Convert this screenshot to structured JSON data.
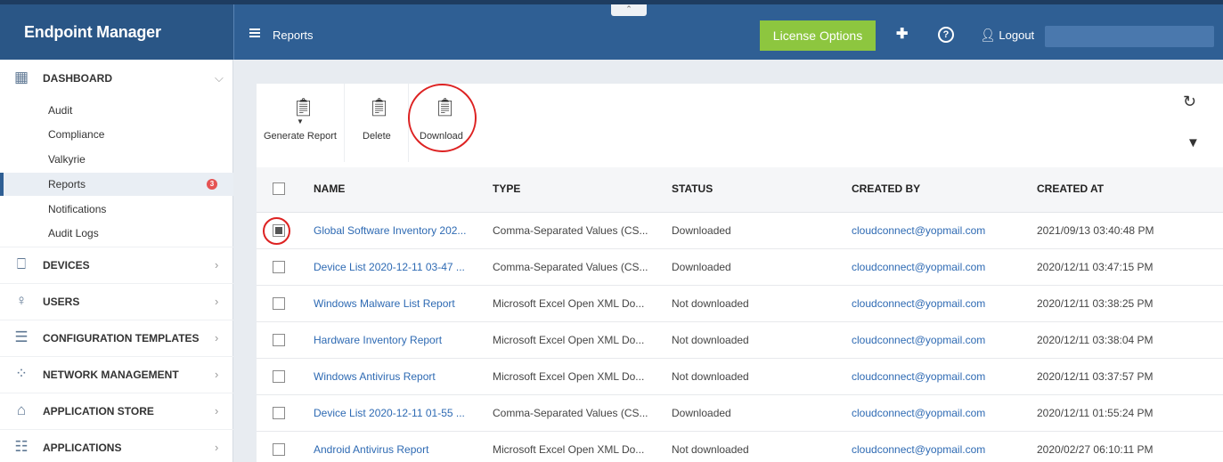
{
  "app": {
    "brand": "Endpoint Manager",
    "page_title": "Reports",
    "license_button": "License Options",
    "logout_label": "Logout"
  },
  "sidebar": {
    "dashboard": {
      "label": "DASHBOARD",
      "icon": "dashboard-grid-icon"
    },
    "sub_items": [
      {
        "label": "Audit"
      },
      {
        "label": "Compliance"
      },
      {
        "label": "Valkyrie"
      },
      {
        "label": "Reports",
        "active": true,
        "badge": "3"
      },
      {
        "label": "Notifications"
      },
      {
        "label": "Audit Logs"
      }
    ],
    "groups": [
      {
        "label": "DEVICES",
        "icon": "devices-icon"
      },
      {
        "label": "USERS",
        "icon": "user-icon"
      },
      {
        "label": "CONFIGURATION TEMPLATES",
        "icon": "templates-icon"
      },
      {
        "label": "NETWORK MANAGEMENT",
        "icon": "network-icon"
      },
      {
        "label": "APPLICATION STORE",
        "icon": "store-icon"
      },
      {
        "label": "APPLICATIONS",
        "icon": "applications-icon"
      }
    ]
  },
  "toolbar": {
    "generate": "Generate Report",
    "delete": "Delete",
    "download": "Download"
  },
  "table": {
    "columns": [
      "NAME",
      "TYPE",
      "STATUS",
      "CREATED BY",
      "CREATED AT"
    ],
    "rows": [
      {
        "name": "Global Software Inventory 202...",
        "type": "Comma-Separated Values (CS...",
        "status": "Downloaded",
        "created_by": "cloudconnect@yopmail.com",
        "created_at": "2021/09/13 03:40:48 PM",
        "checked": true
      },
      {
        "name": "Device List 2020-12-11 03-47 ...",
        "type": "Comma-Separated Values (CS...",
        "status": "Downloaded",
        "created_by": "cloudconnect@yopmail.com",
        "created_at": "2020/12/11 03:47:15 PM"
      },
      {
        "name": "Windows Malware List Report",
        "type": "Microsoft Excel Open XML Do...",
        "status": "Not downloaded",
        "created_by": "cloudconnect@yopmail.com",
        "created_at": "2020/12/11 03:38:25 PM"
      },
      {
        "name": "Hardware Inventory Report",
        "type": "Microsoft Excel Open XML Do...",
        "status": "Not downloaded",
        "created_by": "cloudconnect@yopmail.com",
        "created_at": "2020/12/11 03:38:04 PM"
      },
      {
        "name": "Windows Antivirus Report",
        "type": "Microsoft Excel Open XML Do...",
        "status": "Not downloaded",
        "created_by": "cloudconnect@yopmail.com",
        "created_at": "2020/12/11 03:37:57 PM"
      },
      {
        "name": "Device List 2020-12-11 01-55 ...",
        "type": "Comma-Separated Values (CS...",
        "status": "Downloaded",
        "created_by": "cloudconnect@yopmail.com",
        "created_at": "2020/12/11 01:55:24 PM"
      },
      {
        "name": "Android Antivirus Report",
        "type": "Microsoft Excel Open XML Do...",
        "status": "Not downloaded",
        "created_by": "cloudconnect@yopmail.com",
        "created_at": "2020/02/27 06:10:11 PM"
      }
    ]
  }
}
